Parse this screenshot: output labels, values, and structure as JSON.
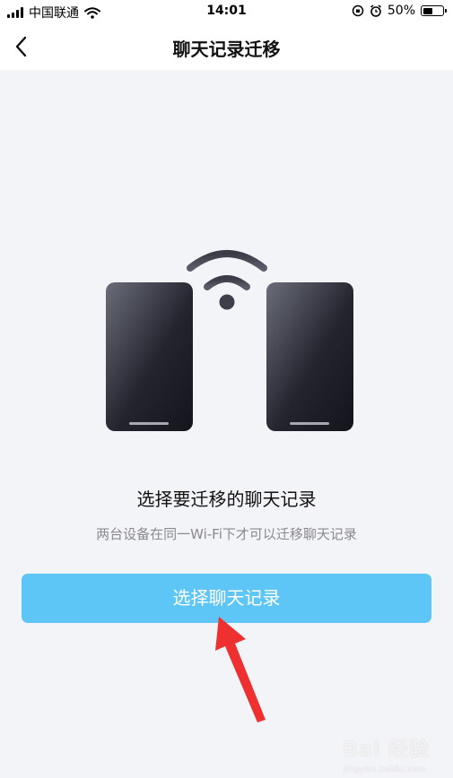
{
  "status_bar": {
    "carrier": "中国联通",
    "time": "14:01",
    "battery_percent": "50%",
    "battery_level": 0.5,
    "icons": [
      "signal-icon",
      "wifi-icon",
      "orientation-lock-icon",
      "alarm-icon",
      "battery-icon"
    ]
  },
  "nav": {
    "title": "聊天记录迁移",
    "back_icon": "chevron-left-icon"
  },
  "main": {
    "illustration_icons": [
      "phone-icon",
      "wifi-icon",
      "phone-icon"
    ],
    "title": "选择要迁移的聊天记录",
    "subtitle": "两台设备在同一Wi-Fi下才可以迁移聊天记录",
    "select_button_label": "选择聊天记录"
  },
  "annotation": {
    "icon": "red-arrow-icon",
    "color": "#ee3030"
  },
  "watermark": {
    "text": "Bai 经验",
    "subtext": "jingyan.baidu.com"
  },
  "colors": {
    "accent": "#5ec6f6",
    "background": "#f3f4f8",
    "subtitle": "#8a8a8e"
  }
}
